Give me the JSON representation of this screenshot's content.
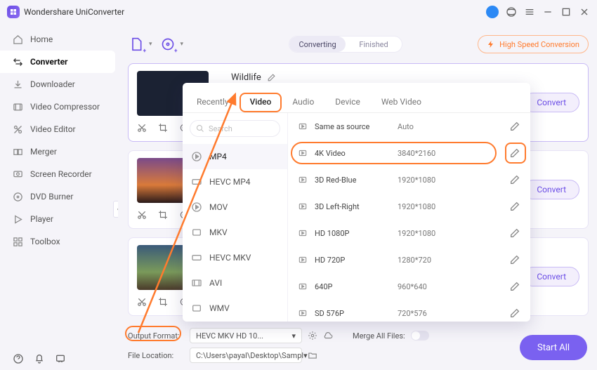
{
  "app": {
    "title": "Wondershare UniConverter"
  },
  "sidebar": {
    "items": [
      {
        "label": "Home"
      },
      {
        "label": "Converter"
      },
      {
        "label": "Downloader"
      },
      {
        "label": "Video Compressor"
      },
      {
        "label": "Video Editor"
      },
      {
        "label": "Merger"
      },
      {
        "label": "Screen Recorder"
      },
      {
        "label": "DVD Burner"
      },
      {
        "label": "Player"
      },
      {
        "label": "Toolbox"
      }
    ]
  },
  "topbar": {
    "segments": {
      "converting": "Converting",
      "finished": "Finished"
    },
    "hsc": "High Speed Conversion"
  },
  "file": {
    "name": "Wildlife"
  },
  "convert_label": "Convert",
  "panel": {
    "tabs": {
      "recently": "Recently",
      "video": "Video",
      "audio": "Audio",
      "device": "Device",
      "web": "Web Video"
    },
    "search_placeholder": "Search",
    "formats": [
      "MP4",
      "HEVC MP4",
      "MOV",
      "MKV",
      "HEVC MKV",
      "AVI",
      "WMV"
    ],
    "resolutions": [
      {
        "name": "Same as source",
        "dim": "Auto"
      },
      {
        "name": "4K Video",
        "dim": "3840*2160"
      },
      {
        "name": "3D Red-Blue",
        "dim": "1920*1080"
      },
      {
        "name": "3D Left-Right",
        "dim": "1920*1080"
      },
      {
        "name": "HD 1080P",
        "dim": "1920*1080"
      },
      {
        "name": "HD 720P",
        "dim": "1280*720"
      },
      {
        "name": "640P",
        "dim": "960*640"
      },
      {
        "name": "SD 576P",
        "dim": "720*576"
      }
    ]
  },
  "footer": {
    "output_format_label": "Output Format:",
    "output_format_value": "HEVC MKV HD 10...",
    "file_location_label": "File Location:",
    "file_location_value": "C:\\Users\\payal\\Desktop\\Sampl",
    "merge_label": "Merge All Files:"
  },
  "start_all": "Start All"
}
